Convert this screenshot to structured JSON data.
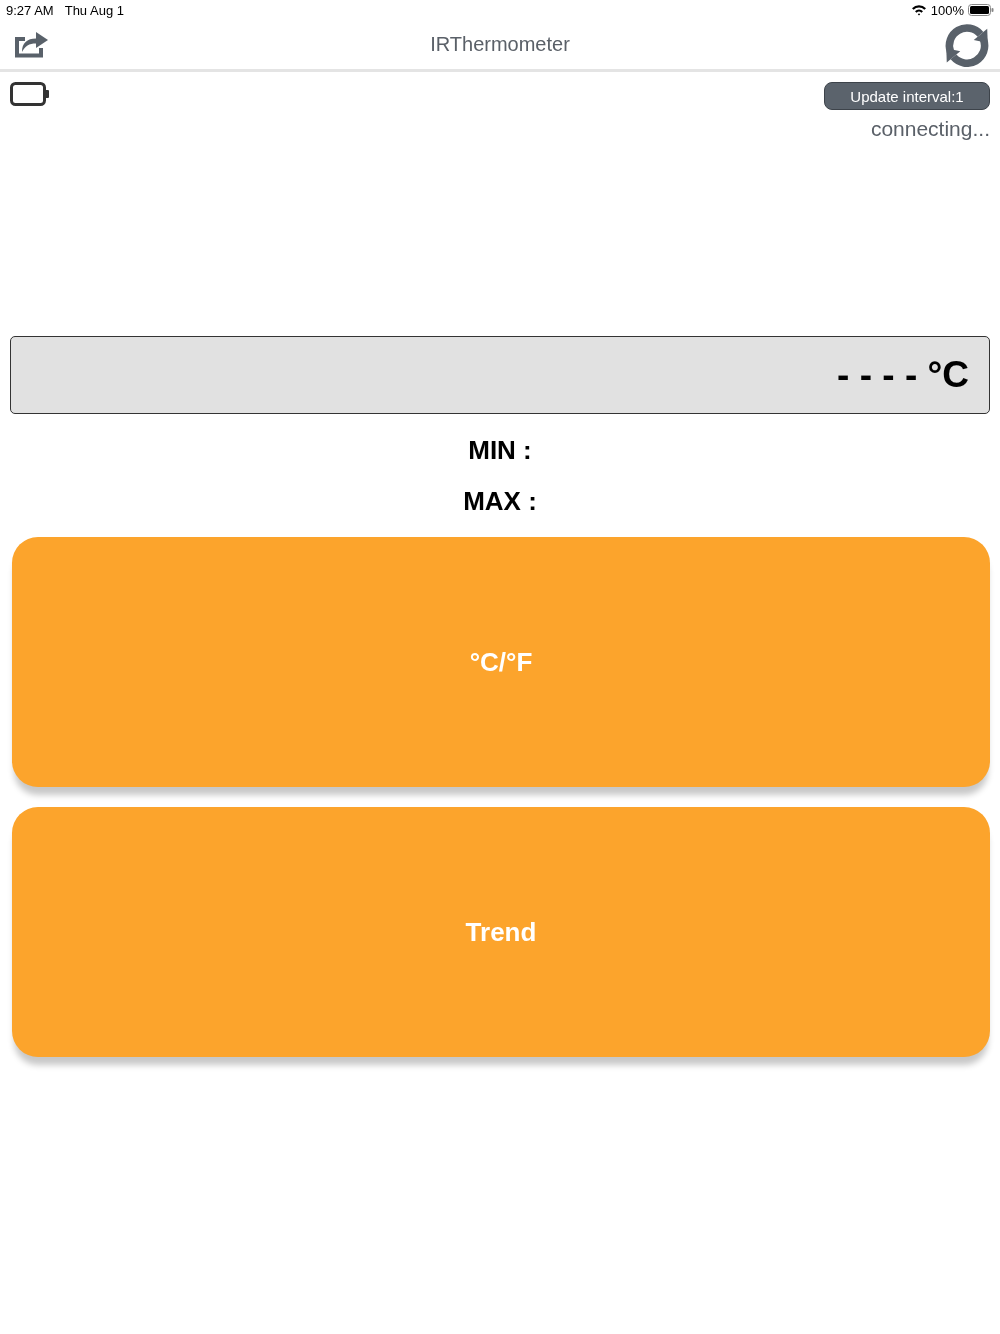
{
  "status_bar": {
    "time": "9:27 AM",
    "date": "Thu Aug 1",
    "battery": "100%"
  },
  "nav_bar": {
    "title": "IRThermometer"
  },
  "device": {
    "update_interval_button": "Update interval:1",
    "connection_status": "connecting..."
  },
  "reading": {
    "value": "- - - - °C"
  },
  "stats": [
    {
      "label": "MIN :"
    },
    {
      "label": "MAX :"
    }
  ],
  "buttons": [
    {
      "label": "°C/°F"
    },
    {
      "label": "Trend"
    }
  ]
}
